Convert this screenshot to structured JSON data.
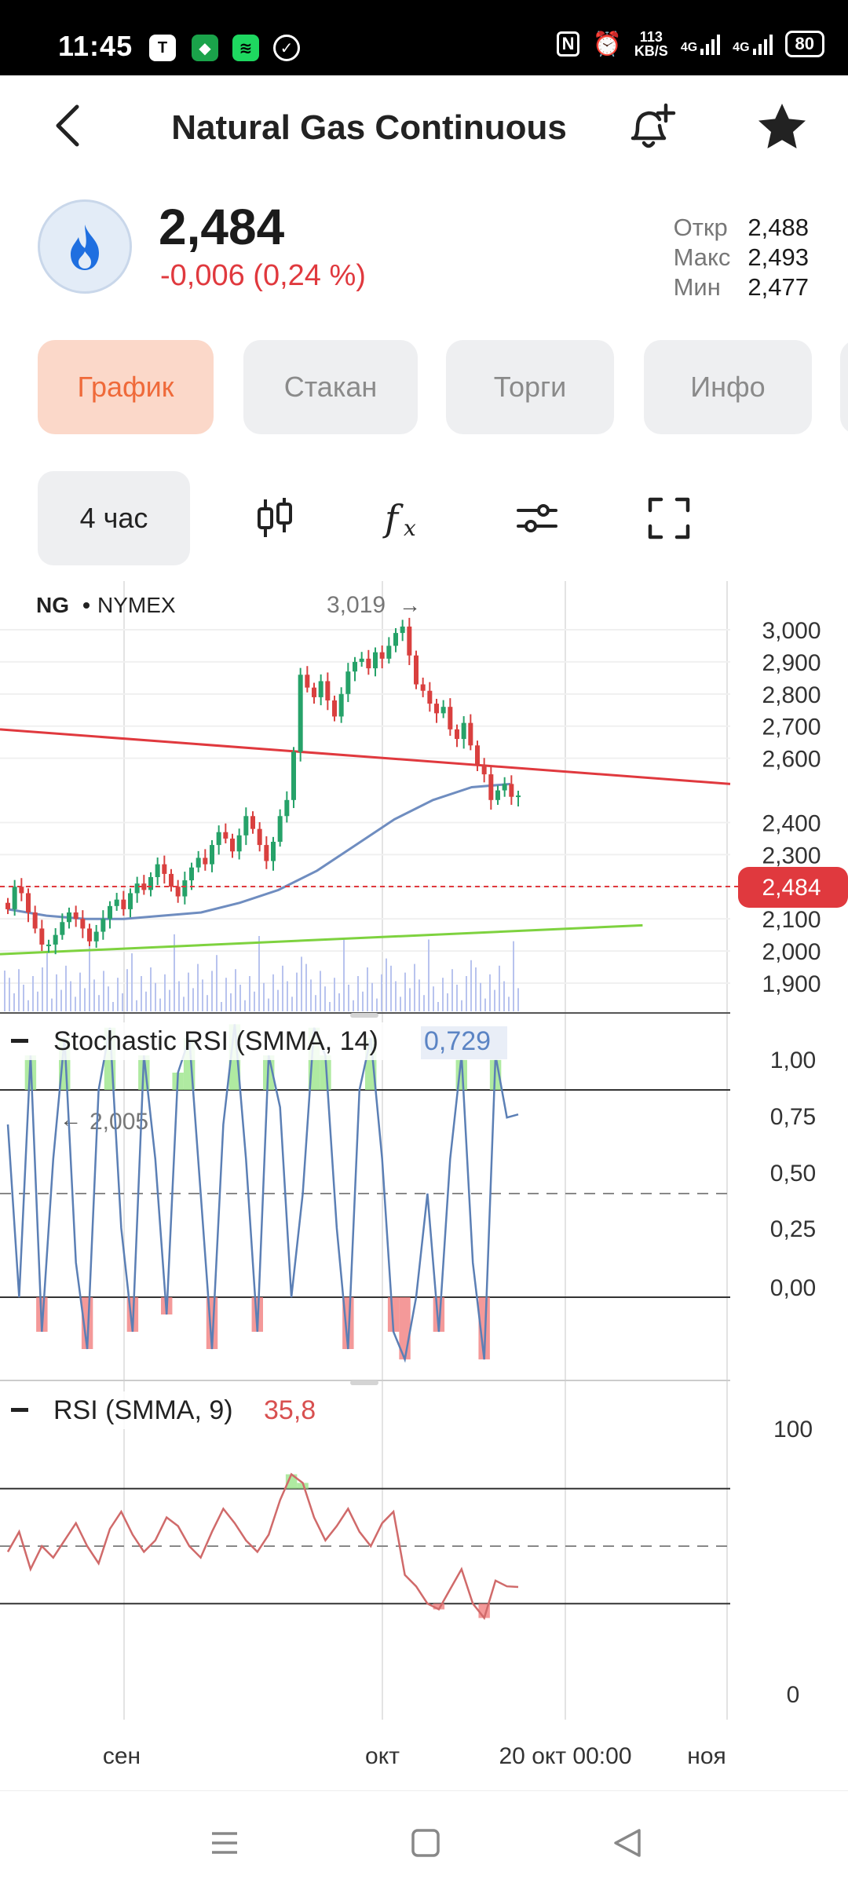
{
  "status_bar": {
    "time": "11:45",
    "speed_value": "113",
    "speed_unit": "KB/S",
    "net1": "4G",
    "net2": "4G",
    "battery": "80",
    "icons": [
      "shield-app-icon",
      "vpn-shield-icon",
      "spotify-icon",
      "check-circle-icon",
      "nfc-icon",
      "alarm-icon",
      "signal-icon"
    ]
  },
  "header": {
    "title": "Natural Gas Continuous",
    "icons": [
      "back-arrow-icon",
      "bell-plus-icon",
      "star-icon"
    ]
  },
  "quote": {
    "icon": "flame-icon",
    "price": "2,484",
    "change": "-0,006 (0,24 %)",
    "open_label": "Откр",
    "open_value": "2,488",
    "high_label": "Макс",
    "high_value": "2,493",
    "low_label": "Мин",
    "low_value": "2,477"
  },
  "tabs": [
    {
      "label": "График",
      "active": true
    },
    {
      "label": "Стакан",
      "active": false
    },
    {
      "label": "Торги",
      "active": false
    },
    {
      "label": "Инфо",
      "active": false
    }
  ],
  "toolbar": {
    "interval": "4 час",
    "icons": [
      "candles-icon",
      "fx-icon",
      "settings-sliders-icon",
      "fullscreen-icon"
    ]
  },
  "chart_data": {
    "type": "candlestick",
    "symbol": "NG",
    "exchange": "NYMEX",
    "interval": "4 час",
    "price_axis": [
      "3,000",
      "2,900",
      "2,800",
      "2,700",
      "2,600",
      "2,484",
      "2,400",
      "2,300",
      "2,200",
      "2,100",
      "2,000",
      "1,900"
    ],
    "ylim": [
      1.85,
      3.05
    ],
    "current_price_label": "2,484",
    "high_marker": "3,019",
    "low_marker": "2,005",
    "x_labels": [
      "сен",
      "окт",
      "20 окт 00:00",
      "ноя"
    ],
    "close_series": [
      2.13,
      2.2,
      2.18,
      2.12,
      2.07,
      2.02,
      2.02,
      2.05,
      2.09,
      2.12,
      2.1,
      2.07,
      2.03,
      2.06,
      2.1,
      2.14,
      2.16,
      2.13,
      2.18,
      2.21,
      2.19,
      2.23,
      2.27,
      2.24,
      2.2,
      2.17,
      2.22,
      2.26,
      2.29,
      2.27,
      2.33,
      2.37,
      2.35,
      2.31,
      2.36,
      2.42,
      2.38,
      2.33,
      2.28,
      2.34,
      2.42,
      2.47,
      2.62,
      2.86,
      2.82,
      2.79,
      2.84,
      2.78,
      2.73,
      2.8,
      2.87,
      2.9,
      2.91,
      2.88,
      2.93,
      2.91,
      2.95,
      2.99,
      3.01,
      2.92,
      2.83,
      2.81,
      2.77,
      2.74,
      2.76,
      2.69,
      2.66,
      2.71,
      2.64,
      2.58,
      2.55,
      2.47,
      2.5,
      2.52,
      2.48,
      2.484
    ],
    "ma_series": [
      2.13,
      2.11,
      2.1,
      2.1,
      2.11,
      2.12,
      2.15,
      2.19,
      2.25,
      2.33,
      2.41,
      2.47,
      2.51,
      2.52
    ],
    "trendlines": [
      {
        "color": "#e0393e",
        "from": [
          0,
          2.69
        ],
        "to": [
          1,
          2.52
        ]
      },
      {
        "color": "#7ed23f",
        "from": [
          0,
          1.99
        ],
        "to": [
          0.88,
          2.08
        ]
      }
    ],
    "indicators": [
      {
        "name": "Stochastic RSI (SMMA, 14)",
        "value": "0,729",
        "axis": [
          "1,00",
          "0,75",
          "0,50",
          "0,25",
          "0,00"
        ],
        "levels": [
          0.8,
          0.5,
          0.2
        ],
        "values": [
          0.7,
          0.2,
          0.9,
          0.1,
          0.6,
          0.95,
          0.3,
          0.05,
          0.8,
          0.98,
          0.4,
          0.1,
          0.9,
          0.6,
          0.15,
          0.85,
          0.95,
          0.5,
          0.05,
          0.7,
          0.99,
          0.6,
          0.1,
          0.9,
          0.75,
          0.2,
          0.5,
          0.98,
          0.9,
          0.4,
          0.05,
          0.8,
          0.95,
          0.6,
          0.1,
          0.02,
          0.2,
          0.5,
          0.1,
          0.6,
          0.9,
          0.3,
          0.02,
          0.9,
          0.72,
          0.729
        ]
      },
      {
        "name": "RSI (SMMA, 9)",
        "value": "35,8",
        "axis": [
          "100",
          "0"
        ],
        "levels": [
          70,
          50,
          30
        ],
        "values": [
          48,
          55,
          42,
          50,
          46,
          52,
          58,
          50,
          44,
          56,
          62,
          54,
          48,
          52,
          60,
          57,
          50,
          46,
          55,
          63,
          58,
          52,
          48,
          54,
          66,
          75,
          72,
          60,
          52,
          57,
          63,
          55,
          50,
          58,
          62,
          40,
          36,
          30,
          28,
          35,
          42,
          30,
          25,
          38,
          36,
          35.8
        ]
      }
    ]
  },
  "nav": {
    "icons": [
      "menu-icon",
      "home-square-icon",
      "back-triangle-icon"
    ]
  }
}
